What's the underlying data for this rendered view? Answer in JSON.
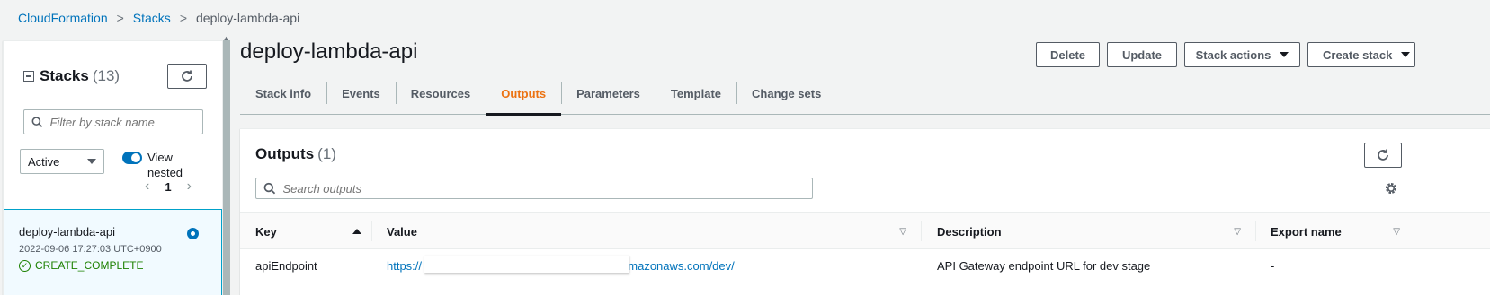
{
  "breadcrumb": {
    "items": [
      "CloudFormation",
      "Stacks"
    ],
    "current": "deploy-lambda-api",
    "separator": ">"
  },
  "left_panel": {
    "title": "Stacks",
    "count": "(13)",
    "filter_placeholder": "Filter by stack name",
    "status_filter": "Active",
    "view_nested_label_1": "View",
    "view_nested_label_2": "nested",
    "view_nested_enabled": true,
    "page": "1",
    "selected_stack": {
      "name": "deploy-lambda-api",
      "timestamp": "2022-09-06 17:27:03 UTC+0900",
      "status": "CREATE_COMPLETE"
    }
  },
  "main": {
    "title": "deploy-lambda-api",
    "buttons": {
      "delete": "Delete",
      "update": "Update",
      "stack_actions": "Stack actions",
      "create_stack": "Create stack"
    },
    "tabs": [
      "Stack info",
      "Events",
      "Resources",
      "Outputs",
      "Parameters",
      "Template",
      "Change sets"
    ],
    "active_tab": "Outputs"
  },
  "outputs": {
    "title": "Outputs",
    "count": "(1)",
    "search_placeholder": "Search outputs",
    "columns": [
      "Key",
      "Value",
      "Description",
      "Export name"
    ],
    "rows": [
      {
        "key": "apiEndpoint",
        "value_prefix": "https://",
        "value_suffix": "amazonaws.com/dev/",
        "description": "API Gateway endpoint URL for dev stage",
        "export_name": "-"
      }
    ]
  },
  "colors": {
    "link": "#0073bb",
    "active_tab": "#ec7211",
    "success": "#1d8102",
    "selected_bg": "#f1faff"
  }
}
